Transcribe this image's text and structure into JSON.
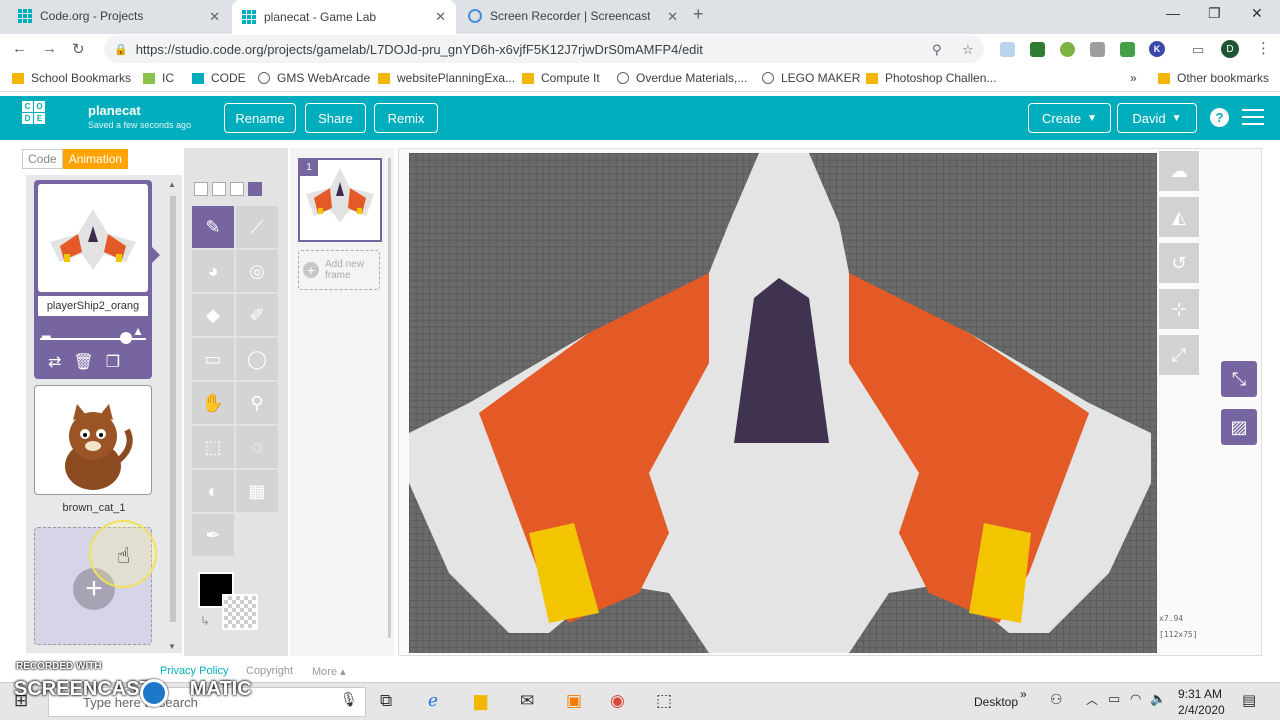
{
  "browser": {
    "tabs": [
      {
        "title": "Code.org - Projects",
        "active": false
      },
      {
        "title": "planecat - Game Lab",
        "active": true
      },
      {
        "title": "Screen Recorder | Screencast-O-M",
        "active": false
      }
    ],
    "new_tab": "+",
    "url": "https://studio.code.org/projects/gamelab/L7DOJd-pru_gnYD6h-x6vjfF5K12J7rjwDrS0mAMFP4/edit",
    "profile_initial": "D",
    "ext_k": "K",
    "bookmarks": [
      {
        "label": "School Bookmarks",
        "icon": "folder"
      },
      {
        "label": "IC",
        "icon": "ic-logo"
      },
      {
        "label": "CODE",
        "icon": "code-logo"
      },
      {
        "label": "GMS WebArcade",
        "icon": "globe"
      },
      {
        "label": "websitePlanningExa...",
        "icon": "doc"
      },
      {
        "label": "Compute It",
        "icon": "doc"
      },
      {
        "label": "Overdue Materials,...",
        "icon": "globe"
      },
      {
        "label": "LEGO MAKER",
        "icon": "globe"
      },
      {
        "label": "Photoshop Challen...",
        "icon": "doc"
      }
    ],
    "bookmarks_more": "»",
    "other_bookmarks": "Other bookmarks"
  },
  "header": {
    "logo_letters": [
      "C",
      "O",
      "D",
      "E"
    ],
    "project_name": "planecat",
    "saved_status": "Saved a few seconds ago",
    "buttons": {
      "rename": "Rename",
      "share": "Share",
      "remix": "Remix"
    },
    "create_label": "Create",
    "user_label": "David",
    "help": "?"
  },
  "mode_tabs": {
    "code": "Code",
    "animation": "Animation"
  },
  "animations": [
    {
      "name": "playerShip2_orang",
      "selected": true
    },
    {
      "name": "brown_cat_1",
      "selected": false
    }
  ],
  "new_animation_label": "+",
  "frames": {
    "number": "1",
    "add_label_1": "Add new",
    "add_label_2": "frame"
  },
  "canvas": {
    "zoom": "x7.94",
    "dimensions": "[112x75]"
  },
  "colors": {
    "primary": "#000000",
    "accent": "#7665a0",
    "header": "#00adbc",
    "tab_orange": "#ffa400"
  },
  "footer": {
    "privacy": "Privacy Policy",
    "copyright": "Copyright",
    "more": "More ▴"
  },
  "watermark": {
    "recorded_with": "RECORDED WITH",
    "brand_left": "SCREENCAST",
    "brand_right": "MATIC"
  },
  "taskbar": {
    "search_placeholder": "Type here to search",
    "desktop_label": "Desktop",
    "time": "9:31 AM",
    "date": "2/4/2020"
  }
}
